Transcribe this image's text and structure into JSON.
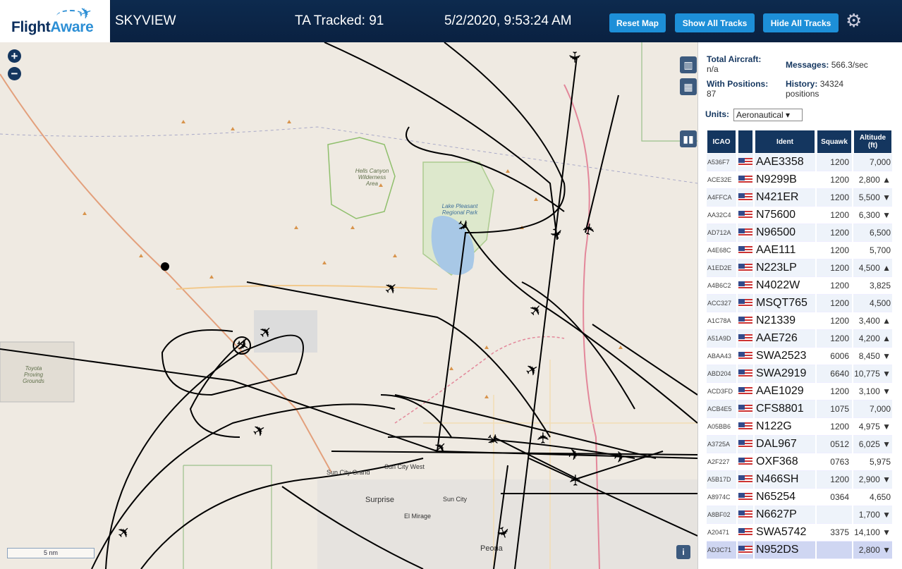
{
  "header": {
    "logo_text_1": "Flight",
    "logo_text_2": "Aware",
    "app_title": "SKYVIEW",
    "tracked": "TA Tracked: 91",
    "datetime": "5/2/2020, 9:53:24 AM",
    "reset_map": "Reset Map",
    "show_all_tracks": "Show All Tracks",
    "hide_all_tracks": "Hide All Tracks"
  },
  "map": {
    "zoom_in": "+",
    "zoom_out": "−",
    "scale": "5 nm",
    "info": "i",
    "labels": {
      "hells_canyon": "Hells Canyon Wilderness Area",
      "lake_pleasant": "Lake Pleasant Regional Park",
      "toyota": "Toyota Proving Grounds",
      "sun_city_grand": "Sun City Grand",
      "sun_city_west": "Sun City West",
      "surprise": "Surprise",
      "sun_city": "Sun City",
      "el_mirage": "El Mirage",
      "peoria": "Peoria"
    },
    "icons": [
      "map-icon",
      "grid-icon",
      "columns-icon"
    ]
  },
  "panel": {
    "total_aircraft_label": "Total Aircraft:",
    "total_aircraft_value": "n/a",
    "messages_label": "Messages:",
    "messages_value": "566.3/sec",
    "with_positions_label": "With Positions:",
    "with_positions_value": "87",
    "history_label": "History:",
    "history_value": "34324",
    "history_unit": "positions",
    "units_label": "Units:",
    "units_value": "Aeronautical",
    "columns": [
      "ICAO",
      "Ident",
      "Squawk",
      "Altitude (ft)"
    ],
    "rows": [
      {
        "icao": "A536F7",
        "ident": "AAE3358",
        "squawk": "1200",
        "alt": "7,000",
        "trend": ""
      },
      {
        "icao": "ACE32E",
        "ident": "N9299B",
        "squawk": "1200",
        "alt": "2,800",
        "trend": "▲"
      },
      {
        "icao": "A4FFCA",
        "ident": "N421ER",
        "squawk": "1200",
        "alt": "5,500",
        "trend": "▼"
      },
      {
        "icao": "AA32C4",
        "ident": "N75600",
        "squawk": "1200",
        "alt": "6,300",
        "trend": "▼"
      },
      {
        "icao": "AD712A",
        "ident": "N96500",
        "squawk": "1200",
        "alt": "6,500",
        "trend": ""
      },
      {
        "icao": "A4E68C",
        "ident": "AAE111",
        "squawk": "1200",
        "alt": "5,700",
        "trend": ""
      },
      {
        "icao": "A1ED2E",
        "ident": "N223LP",
        "squawk": "1200",
        "alt": "4,500",
        "trend": "▲"
      },
      {
        "icao": "A4B6C2",
        "ident": "N4022W",
        "squawk": "1200",
        "alt": "3,825",
        "trend": ""
      },
      {
        "icao": "ACC327",
        "ident": "MSQT765",
        "squawk": "1200",
        "alt": "4,500",
        "trend": ""
      },
      {
        "icao": "A1C78A",
        "ident": "N21339",
        "squawk": "1200",
        "alt": "3,400",
        "trend": "▲"
      },
      {
        "icao": "A51A9D",
        "ident": "AAE726",
        "squawk": "1200",
        "alt": "4,200",
        "trend": "▲"
      },
      {
        "icao": "ABAA43",
        "ident": "SWA2523",
        "squawk": "6006",
        "alt": "8,450",
        "trend": "▼"
      },
      {
        "icao": "ABD204",
        "ident": "SWA2919",
        "squawk": "6640",
        "alt": "10,775",
        "trend": "▼"
      },
      {
        "icao": "ACD3FD",
        "ident": "AAE1029",
        "squawk": "1200",
        "alt": "3,100",
        "trend": "▼"
      },
      {
        "icao": "ACB4E5",
        "ident": "CFS8801",
        "squawk": "1075",
        "alt": "7,000",
        "trend": ""
      },
      {
        "icao": "A05BB6",
        "ident": "N122G",
        "squawk": "1200",
        "alt": "4,975",
        "trend": "▼"
      },
      {
        "icao": "A3725A",
        "ident": "DAL967",
        "squawk": "0512",
        "alt": "6,025",
        "trend": "▼"
      },
      {
        "icao": "A2F227",
        "ident": "OXF368",
        "squawk": "0763",
        "alt": "5,975",
        "trend": ""
      },
      {
        "icao": "A5B17D",
        "ident": "N466SH",
        "squawk": "1200",
        "alt": "2,900",
        "trend": "▼"
      },
      {
        "icao": "A8974C",
        "ident": "N65254",
        "squawk": "0364",
        "alt": "4,650",
        "trend": ""
      },
      {
        "icao": "A8BF02",
        "ident": "N6627P",
        "squawk": "",
        "alt": "1,700",
        "trend": "▼"
      },
      {
        "icao": "A20471",
        "ident": "SWA5742",
        "squawk": "3375",
        "alt": "14,100",
        "trend": "▼"
      },
      {
        "icao": "AD3C71",
        "ident": "N952DS",
        "squawk": "",
        "alt": "2,800",
        "trend": "▼"
      }
    ]
  },
  "colors": {
    "header_bg": "#0a2141",
    "button": "#1d8fd8",
    "table_header": "#14365f",
    "track": "#000000"
  }
}
